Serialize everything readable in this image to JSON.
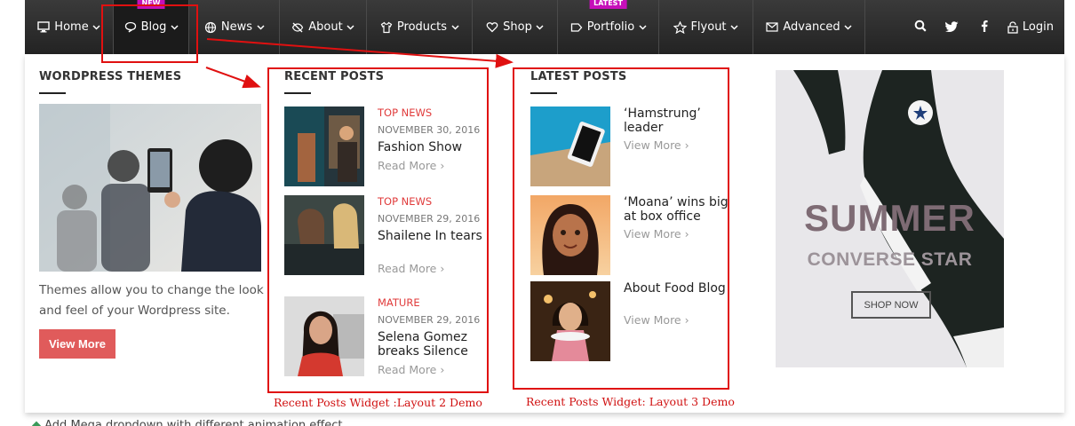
{
  "nav": {
    "items": [
      {
        "label": "Home",
        "icon": "monitor-icon"
      },
      {
        "label": "Blog",
        "icon": "chat-bubble-icon",
        "badge": "NEW"
      },
      {
        "label": "News",
        "icon": "globe-icon"
      },
      {
        "label": "About",
        "icon": "eye-slash-icon"
      },
      {
        "label": "Products",
        "icon": "shirt-icon"
      },
      {
        "label": "Shop",
        "icon": "heart-icon"
      },
      {
        "label": "Portfolio",
        "icon": "tag-icon",
        "badge": "LATEST"
      },
      {
        "label": "Flyout",
        "icon": "star-icon"
      },
      {
        "label": "Advanced",
        "icon": "envelope-icon"
      }
    ],
    "login_label": "Login",
    "badge_color": "#c60fb9"
  },
  "wordpress": {
    "title": "WORDPRESS THEMES",
    "text": "Themes allow you to change the look and feel of your Wordpress site.",
    "button": "View More",
    "button_color": "#e05b5b"
  },
  "recent": {
    "title": "RECENT POSTS",
    "posts": [
      {
        "category": "TOP NEWS",
        "date": "NOVEMBER 30, 2016",
        "title": "Fashion Show",
        "more": "Read More"
      },
      {
        "category": "TOP NEWS",
        "date": "NOVEMBER 29, 2016",
        "title": "Shailene In tears",
        "more": "Read More"
      },
      {
        "category": "MATURE",
        "date": "NOVEMBER 29, 2016",
        "title": "Selena Gomez breaks Silence",
        "more": "Read More"
      }
    ]
  },
  "latest": {
    "title": "LATEST POSTS",
    "posts": [
      {
        "title": "‘Hamstrung’ leader",
        "more": "View More"
      },
      {
        "title": "‘Moana’ wins big at box office",
        "more": "View More"
      },
      {
        "title": "About Food Blog",
        "more": "View More"
      }
    ]
  },
  "ad": {
    "title": "SUMMER",
    "subtitle": "CONVERSE STAR",
    "button": "SHOP NOW"
  },
  "annotations": {
    "caption_layout2": "Recent Posts Widget :Layout 2 Demo",
    "caption_layout3": "Recent Posts Widget: Layout 3 Demo",
    "color": "#e01010"
  },
  "footer": {
    "text": "Add Mega dropdown with different animation effect"
  }
}
